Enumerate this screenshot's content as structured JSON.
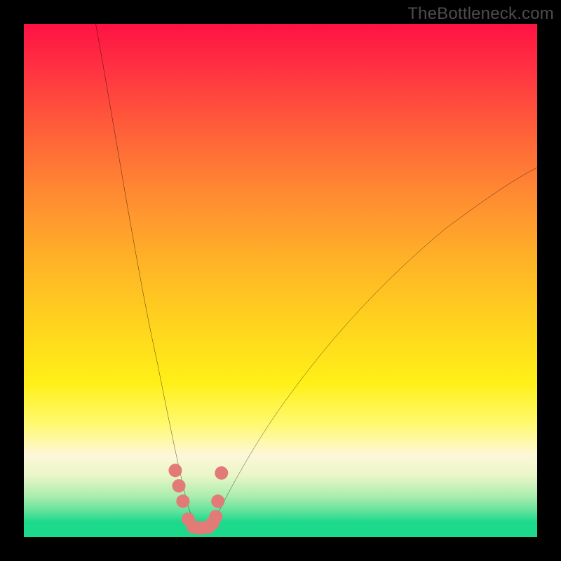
{
  "watermark": "TheBottleneck.com",
  "chart_data": {
    "type": "line",
    "title": "",
    "xlabel": "",
    "ylabel": "",
    "xlim": [
      0,
      100
    ],
    "ylim": [
      0,
      100
    ],
    "background_gradient": {
      "top_color": "#ff1243",
      "mid_color": "#fff018",
      "bottom_color": "#1cd98c"
    },
    "series": [
      {
        "name": "bottleneck-curve",
        "x": [
          14,
          16,
          18,
          20,
          22,
          24,
          26,
          28,
          30,
          31,
          32,
          33,
          34,
          35,
          36,
          37,
          38,
          40,
          44,
          50,
          58,
          68,
          80,
          92,
          100
        ],
        "y": [
          100,
          90,
          80,
          68,
          56,
          44,
          32,
          22,
          12,
          8,
          5,
          3,
          2,
          2,
          2,
          3,
          4,
          7,
          14,
          23,
          34,
          46,
          58,
          67,
          72
        ]
      },
      {
        "name": "highlight-dots",
        "x": [
          29.5,
          30.2,
          31.0,
          32.0,
          33.0,
          34.0,
          35.0,
          36.0,
          36.8,
          37.4,
          37.8,
          38.5
        ],
        "y": [
          13.0,
          10.0,
          7.0,
          3.5,
          2.0,
          1.8,
          1.8,
          2.0,
          2.8,
          4.0,
          7.0,
          12.5
        ]
      }
    ]
  }
}
